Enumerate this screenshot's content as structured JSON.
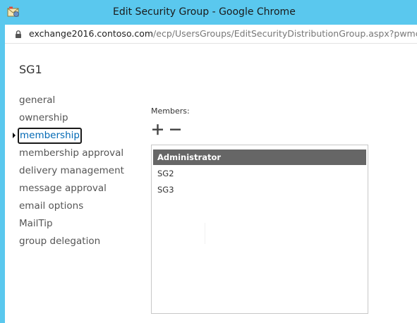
{
  "window": {
    "title": "Edit Security Group - Google Chrome",
    "icon": "exchange-envelope-icon",
    "frame_color": "#5ac8ee"
  },
  "address_bar": {
    "lock_icon": "lock-icon",
    "url_host": "exchange2016.contoso.com",
    "url_path": "/ecp/UsersGroups/EditSecurityDistributionGroup.aspx?pwmci"
  },
  "page": {
    "title": "SG1"
  },
  "nav": {
    "items": [
      {
        "label": "general",
        "selected": false
      },
      {
        "label": "ownership",
        "selected": false
      },
      {
        "label": "membership",
        "selected": true
      },
      {
        "label": "membership approval",
        "selected": false
      },
      {
        "label": "delivery management",
        "selected": false
      },
      {
        "label": "message approval",
        "selected": false
      },
      {
        "label": "email options",
        "selected": false
      },
      {
        "label": "MailTip",
        "selected": false
      },
      {
        "label": "group delegation",
        "selected": false
      }
    ],
    "selected_color": "#0068b4"
  },
  "members": {
    "label": "Members:",
    "add_icon": "plus-icon",
    "remove_icon": "minus-icon",
    "rows": [
      {
        "name": "Administrator",
        "selected": true
      },
      {
        "name": "SG2",
        "selected": false
      },
      {
        "name": "SG3",
        "selected": false
      }
    ],
    "selected_row_color": "#666666"
  }
}
